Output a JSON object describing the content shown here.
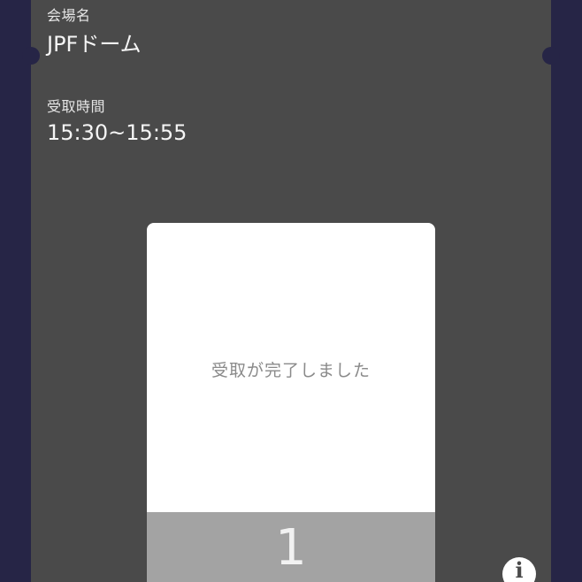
{
  "ticket": {
    "venue_label": "会場名",
    "venue_value": "JPFドーム",
    "time_label": "受取時間",
    "time_value": "15:30~15:55"
  },
  "modal": {
    "message": "受取が完了しました",
    "count": "1"
  },
  "info_button": {
    "icon": "info-icon",
    "glyph": "i"
  },
  "colors": {
    "background": "#262546",
    "ticket": "#4a4a4a",
    "modal": "#ffffff",
    "modal_footer": "#a3a3a3"
  }
}
